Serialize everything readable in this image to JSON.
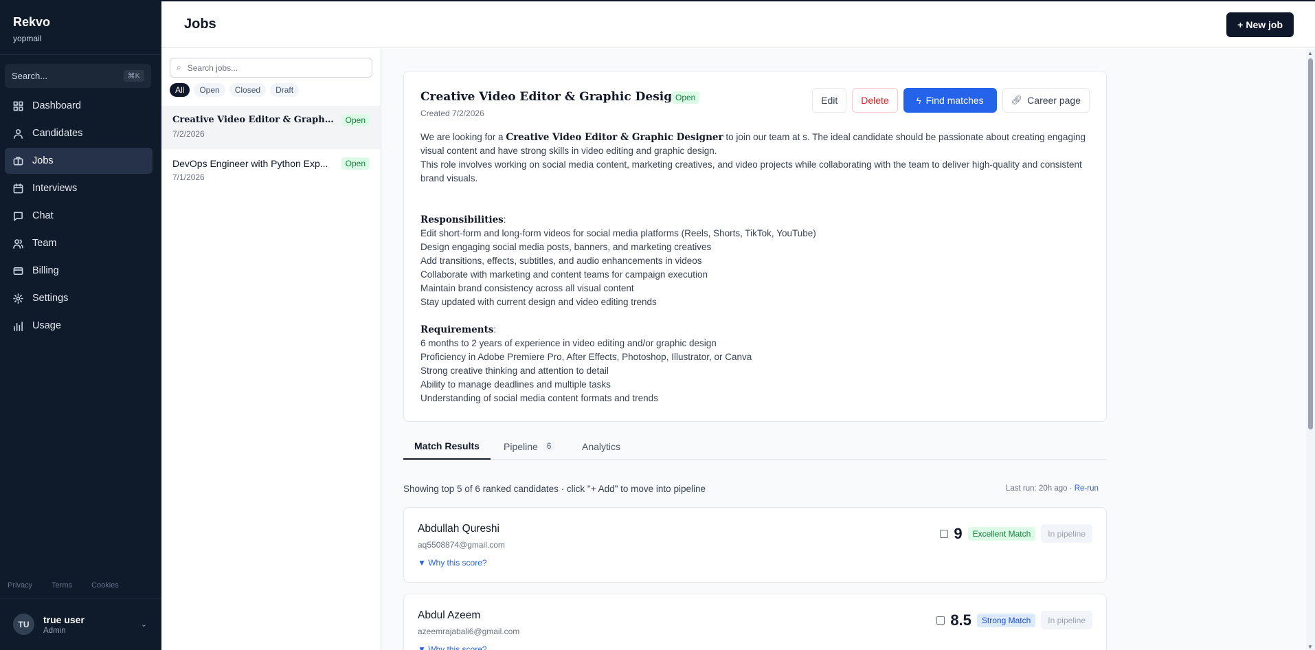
{
  "sidebar": {
    "brand": "Rekvo",
    "org": "yopmail",
    "search_placeholder": "Search...",
    "search_shortcut": "⌘K",
    "items": [
      {
        "label": "Dashboard",
        "icon": "dashboard-icon"
      },
      {
        "label": "Candidates",
        "icon": "users-icon"
      },
      {
        "label": "Jobs",
        "icon": "briefcase-icon",
        "active": true
      },
      {
        "label": "Interviews",
        "icon": "calendar-icon"
      },
      {
        "label": "Chat",
        "icon": "chat-icon"
      },
      {
        "label": "Team",
        "icon": "team-icon"
      },
      {
        "label": "Billing",
        "icon": "credit-card-icon"
      },
      {
        "label": "Settings",
        "icon": "gear-icon"
      },
      {
        "label": "Usage",
        "icon": "bar-chart-icon"
      }
    ],
    "legal": {
      "privacy": "Privacy",
      "terms": "Terms",
      "cookies": "Cookies"
    },
    "user": {
      "initials": "TU",
      "name": "true user",
      "role": "Admin"
    }
  },
  "header": {
    "title": "Jobs",
    "new_job": "+ New job"
  },
  "joblist": {
    "search_placeholder": "Search jobs...",
    "filters": [
      "All",
      "Open",
      "Closed",
      "Draft"
    ],
    "jobs": [
      {
        "title": "Creative Video Editor & Graphic D...",
        "date": "7/2/2026",
        "status": "Open"
      },
      {
        "title": "DevOps Engineer with Python Exp...",
        "date": "7/1/2026",
        "status": "Open"
      }
    ]
  },
  "job": {
    "title": "Creative Video Editor & Graphic Designer",
    "status": "Open",
    "created": "Created 7/2/2026",
    "actions": {
      "edit": "Edit",
      "delete": "Delete",
      "find": "Find matches",
      "career": "Career page"
    },
    "intro_pre": "We are looking for a ",
    "intro_bold": "Creative Video Editor & Graphic Designer",
    "intro_post": " to join our team at s. The ideal candidate should be passionate about creating engaging visual content and have strong skills in video editing and graphic design.",
    "intro_2": "This role involves working on social media content, marketing creatives, and video projects while collaborating with the team to deliver high-quality and consistent brand visuals.",
    "resp_heading": "Responsibilities",
    "responsibilities": [
      "Edit short-form and long-form videos for social media platforms (Reels, Shorts, TikTok, YouTube)",
      "Design engaging social media posts, banners, and marketing creatives",
      "Add transitions, effects, subtitles, and audio enhancements in videos",
      "Collaborate with marketing and content teams for campaign execution",
      "Maintain brand consistency across all visual content",
      "Stay updated with current design and video editing trends"
    ],
    "req_heading": "Requirements",
    "requirements": [
      "6 months to 2 years of experience in video editing and/or graphic design",
      "Proficiency in Adobe Premiere Pro, After Effects, Photoshop, Illustrator, or Canva",
      "Strong creative thinking and attention to detail",
      "Ability to manage deadlines and multiple tasks",
      "Understanding of social media content formats and trends"
    ]
  },
  "tabs": {
    "match": "Match Results",
    "pipeline": "Pipeline",
    "pipeline_count": "6",
    "analytics": "Analytics"
  },
  "results": {
    "summary": "Showing top 5 of 6 ranked candidates · click \"+ Add\" to move into pipeline",
    "last_run": "Last run: 20h ago · ",
    "rerun": "Re-run",
    "why": "▼ Why this score?",
    "candidates": [
      {
        "name": "Abdullah Qureshi",
        "email": "aq5508874@gmail.com",
        "score": "9",
        "match": "Excellent Match",
        "state": "In pipeline"
      },
      {
        "name": "Abdul Azeem",
        "email": "azeemrajabali6@gmail.com",
        "score": "8.5",
        "match": "Strong Match",
        "state": "In pipeline"
      }
    ]
  },
  "colors": {
    "sidebar_bg": "#0f1a2b",
    "primary": "#2563eb",
    "open_badge": "#15803d",
    "danger": "#dc2626"
  }
}
